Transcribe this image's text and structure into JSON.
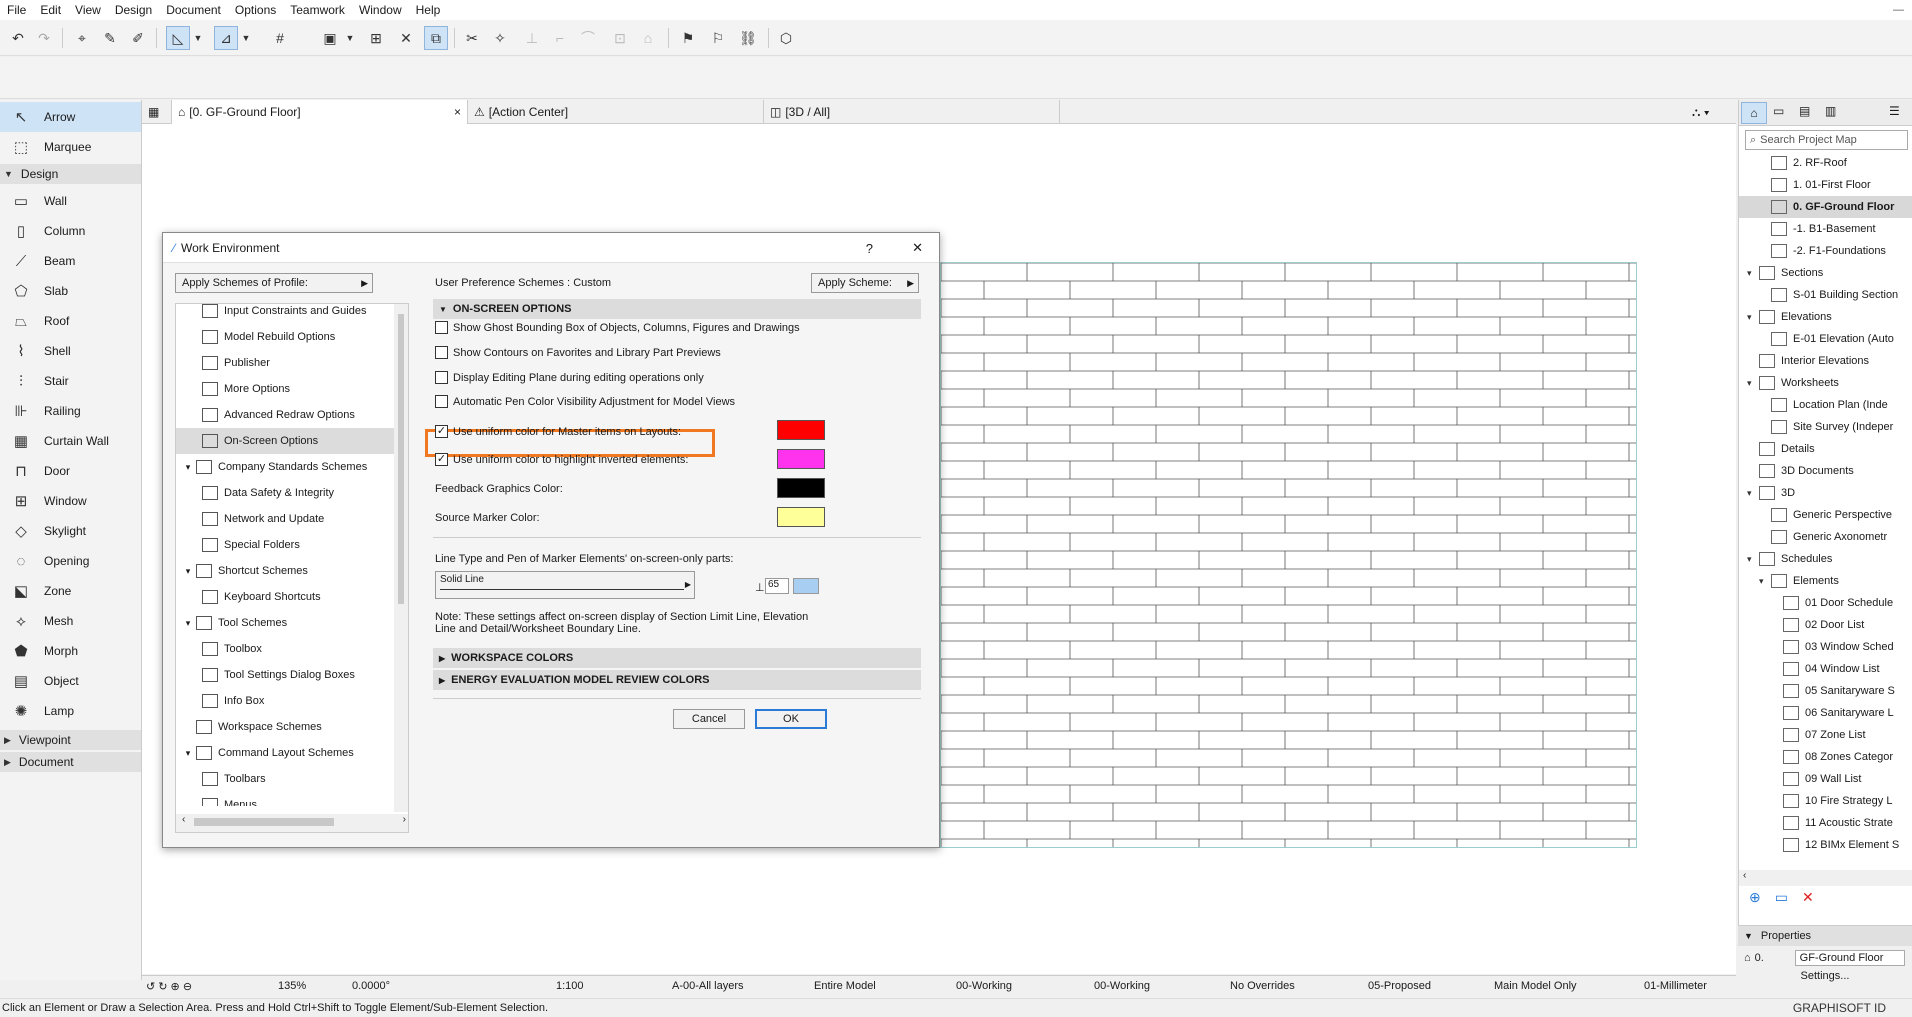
{
  "menubar": {
    "items": [
      "File",
      "Edit",
      "View",
      "Design",
      "Document",
      "Options",
      "Teamwork",
      "Window",
      "Help"
    ]
  },
  "tabs": [
    {
      "label": "[0. GF-Ground Floor]",
      "close": "×"
    },
    {
      "label": "[Action Center]"
    },
    {
      "label": "[3D / All]"
    }
  ],
  "toolbox": {
    "top_tools": [
      {
        "label": "Arrow",
        "icon": "arrow-icon"
      },
      {
        "label": "Marquee",
        "icon": "marquee-icon"
      }
    ],
    "design_group": "Design",
    "design_tools": [
      {
        "label": "Wall",
        "icon": "wall-icon"
      },
      {
        "label": "Column",
        "icon": "column-icon"
      },
      {
        "label": "Beam",
        "icon": "beam-icon"
      },
      {
        "label": "Slab",
        "icon": "slab-icon"
      },
      {
        "label": "Roof",
        "icon": "roof-icon"
      },
      {
        "label": "Shell",
        "icon": "shell-icon"
      },
      {
        "label": "Stair",
        "icon": "stair-icon"
      },
      {
        "label": "Railing",
        "icon": "railing-icon"
      },
      {
        "label": "Curtain Wall",
        "icon": "curtain-wall-icon"
      },
      {
        "label": "Door",
        "icon": "door-icon"
      },
      {
        "label": "Window",
        "icon": "window-icon"
      },
      {
        "label": "Skylight",
        "icon": "skylight-icon"
      },
      {
        "label": "Opening",
        "icon": "opening-icon"
      },
      {
        "label": "Zone",
        "icon": "zone-icon"
      },
      {
        "label": "Mesh",
        "icon": "mesh-icon"
      },
      {
        "label": "Morph",
        "icon": "morph-icon"
      },
      {
        "label": "Object",
        "icon": "object-icon"
      },
      {
        "label": "Lamp",
        "icon": "lamp-icon"
      }
    ],
    "viewpoint_group": "Viewpoint",
    "document_group": "Document"
  },
  "navigator": {
    "search_placeholder": "Search Project Map",
    "items": [
      {
        "label": "2. RF-Roof",
        "indent": 2
      },
      {
        "label": "1. 01-First Floor",
        "indent": 2
      },
      {
        "label": "0. GF-Ground Floor",
        "indent": 2,
        "selected": true
      },
      {
        "label": "-1. B1-Basement",
        "indent": 2
      },
      {
        "label": "-2. F1-Foundations",
        "indent": 2
      },
      {
        "label": "Sections",
        "indent": 1,
        "expanded": true
      },
      {
        "label": "S-01 Building Section",
        "indent": 2
      },
      {
        "label": "Elevations",
        "indent": 1,
        "expanded": true
      },
      {
        "label": "E-01 Elevation (Auto",
        "indent": 2
      },
      {
        "label": "Interior Elevations",
        "indent": 1
      },
      {
        "label": "Worksheets",
        "indent": 1,
        "expanded": true
      },
      {
        "label": "Location Plan (Inde",
        "indent": 2
      },
      {
        "label": "Site Survey (Indeper",
        "indent": 2
      },
      {
        "label": "Details",
        "indent": 1
      },
      {
        "label": "3D Documents",
        "indent": 1
      },
      {
        "label": "3D",
        "indent": 1,
        "expanded": true
      },
      {
        "label": "Generic Perspective",
        "indent": 2
      },
      {
        "label": "Generic Axonometr",
        "indent": 2
      },
      {
        "label": "Schedules",
        "indent": 1,
        "expanded": true
      },
      {
        "label": "Elements",
        "indent": 2,
        "expanded": true
      },
      {
        "label": "01 Door Schedule",
        "indent": 3
      },
      {
        "label": "02 Door List",
        "indent": 3
      },
      {
        "label": "03 Window Sched",
        "indent": 3
      },
      {
        "label": "04 Window List",
        "indent": 3
      },
      {
        "label": "05 Sanitaryware S",
        "indent": 3
      },
      {
        "label": "06 Sanitaryware L",
        "indent": 3
      },
      {
        "label": "07 Zone List",
        "indent": 3
      },
      {
        "label": "08 Zones Categor",
        "indent": 3
      },
      {
        "label": "09 Wall List",
        "indent": 3
      },
      {
        "label": "10 Fire Strategy L",
        "indent": 3
      },
      {
        "label": "11 Acoustic Strate",
        "indent": 3
      },
      {
        "label": "12 BIMx Element S",
        "indent": 3
      }
    ],
    "properties_label": "Properties",
    "prop_id": "0.",
    "prop_value": "GF-Ground Floor",
    "settings_button": "Settings..."
  },
  "statusbar": {
    "zoom": "135%",
    "angle": "0.0000°",
    "scale": "1:100",
    "layers": "A-00-All layers",
    "model": "Entire Model",
    "pen1": "00-Working",
    "pen2": "00-Working",
    "overrides": "No Overrides",
    "reno": "05-Proposed",
    "structure": "Main Model Only",
    "dimension": "01-Millimeter"
  },
  "hint": "Click an Element or Draw a Selection Area. Press and Hold Ctrl+Shift to Toggle Element/Sub-Element Selection.",
  "brand": "GRAPHISOFT ID",
  "dialog": {
    "title": "Work Environment",
    "help": "?",
    "close": "✕",
    "apply_profile": "Apply Schemes of Profile:",
    "scheme_label": "User Preference Schemes :",
    "scheme_value": "Custom",
    "apply_scheme": "Apply Scheme:",
    "tree": [
      {
        "label": "Input Constraints and Guides",
        "level": 2,
        "icon": "input-constraints-icon"
      },
      {
        "label": "Model Rebuild Options",
        "level": 2,
        "icon": "rebuild-icon"
      },
      {
        "label": "Publisher",
        "level": 2,
        "icon": "publisher-icon"
      },
      {
        "label": "More Options",
        "level": 2,
        "icon": "more-options-icon"
      },
      {
        "label": "Advanced Redraw Options",
        "level": 2,
        "icon": "redraw-icon"
      },
      {
        "label": "On-Screen Options",
        "level": 2,
        "icon": "on-screen-icon",
        "selected": true
      },
      {
        "label": "Company Standards Schemes",
        "level": 1,
        "icon": "company-standards-icon",
        "expanded": true
      },
      {
        "label": "Data Safety & Integrity",
        "level": 2,
        "icon": "data-safety-icon"
      },
      {
        "label": "Network and Update",
        "level": 2,
        "icon": "network-icon"
      },
      {
        "label": "Special Folders",
        "level": 2,
        "icon": "folder-icon"
      },
      {
        "label": "Shortcut Schemes",
        "level": 1,
        "icon": "shortcut-icon",
        "expanded": true
      },
      {
        "label": "Keyboard Shortcuts",
        "level": 2,
        "icon": "keyboard-icon"
      },
      {
        "label": "Tool Schemes",
        "level": 1,
        "icon": "tool-schemes-icon",
        "expanded": true
      },
      {
        "label": "Toolbox",
        "level": 2,
        "icon": "toolbox-icon"
      },
      {
        "label": "Tool Settings Dialog Boxes",
        "level": 2,
        "icon": "tool-settings-icon"
      },
      {
        "label": "Info Box",
        "level": 2,
        "icon": "info-box-icon"
      },
      {
        "label": "Workspace Schemes",
        "level": 1,
        "icon": "workspace-icon"
      },
      {
        "label": "Command Layout Schemes",
        "level": 1,
        "icon": "command-layout-icon",
        "expanded": true
      },
      {
        "label": "Toolbars",
        "level": 2,
        "icon": "toolbars-icon"
      },
      {
        "label": "Menus",
        "level": 2,
        "icon": "menus-icon"
      }
    ],
    "section_onscreen": "ON-SCREEN OPTIONS",
    "options": [
      {
        "label": "Show Ghost Bounding Box of Objects, Columns, Figures and Drawings",
        "checked": false
      },
      {
        "label": "Show Contours on Favorites and Library Part Previews",
        "checked": false
      },
      {
        "label": "Display Editing Plane during editing operations only",
        "checked": false
      },
      {
        "label": "Automatic Pen Color Visibility Adjustment for Model Views",
        "checked": false
      },
      {
        "label": "Use uniform color for Master items on Layouts:",
        "checked": true
      },
      {
        "label": "Use uniform color to highlight inverted elements:",
        "checked": true
      }
    ],
    "feedback_label": "Feedback Graphics Color:",
    "source_label": "Source Marker Color:",
    "colors": {
      "master": "#ff0000",
      "inverted": "#ff33ee",
      "feedback": "#000000",
      "source": "#ffff99",
      "highlight": "#f07820"
    },
    "linetype_label": "Line Type and Pen of Marker Elements' on-screen-only parts:",
    "linetype_value": "Solid Line",
    "pen_value": "65",
    "note": "Note: These settings affect on-screen display of Section Limit Line, Elevation Line and Detail/Worksheet Boundary Line.",
    "section_workspace": "WORKSPACE COLORS",
    "section_energy": "ENERGY EVALUATION MODEL REVIEW COLORS",
    "cancel": "Cancel",
    "ok": "OK"
  }
}
